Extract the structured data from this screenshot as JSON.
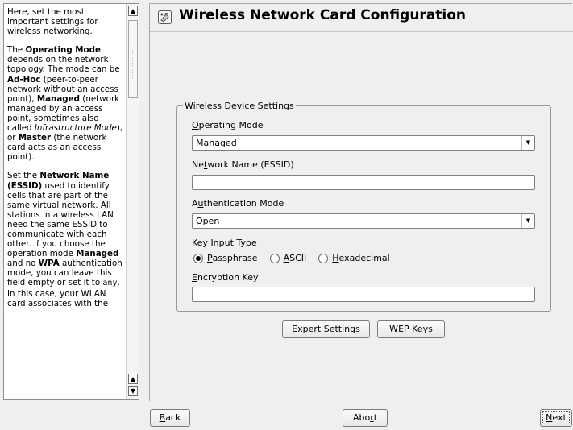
{
  "help": {
    "paragraphs": [
      [
        {
          "t": "Here, set the most important settings for wireless networking."
        }
      ],
      [
        {
          "t": "The "
        },
        {
          "t": "Operating Mode",
          "b": true
        },
        {
          "t": " depends on the network topology. The mode can be "
        },
        {
          "t": "Ad-Hoc",
          "b": true
        },
        {
          "t": " (peer-to-peer network without an access point), "
        },
        {
          "t": "Managed",
          "b": true
        },
        {
          "t": " (network managed by an access point, sometimes also called "
        },
        {
          "t": "Infrastructure Mode",
          "i": true
        },
        {
          "t": "), or "
        },
        {
          "t": "Master",
          "b": true
        },
        {
          "t": " (the network card acts as an access point)."
        }
      ],
      [
        {
          "t": "Set the "
        },
        {
          "t": "Network Name (ESSID)",
          "b": true
        },
        {
          "t": " used to identify cells that are part of the same virtual network. All stations in a wireless LAN need the same ESSID to communicate with each other. If you choose the operation mode "
        },
        {
          "t": "Managed",
          "b": true
        },
        {
          "t": " and no "
        },
        {
          "t": "WPA",
          "b": true
        },
        {
          "t": " authentication mode, you can leave this field empty or set it to "
        },
        {
          "t": "any",
          "code": true
        },
        {
          "t": ". In this case, your WLAN card associates with the"
        }
      ]
    ],
    "scroll_up_icon": "triangle-up",
    "scroll_down_icon": "triangle-down"
  },
  "page": {
    "title": "Wireless Network Card Configuration",
    "icon": "wireless-card-icon"
  },
  "group": {
    "title": "Wireless Device Settings",
    "operating_mode": {
      "label_mn": "O",
      "label_rest": "perating Mode",
      "value": "Managed"
    },
    "essid": {
      "label_pre": "Ne",
      "label_mn": "t",
      "label_rest": "work Name (ESSID)",
      "value": ""
    },
    "auth_mode": {
      "label_pre": "A",
      "label_mn": "u",
      "label_rest": "thentication Mode",
      "value": "Open"
    },
    "key_input": {
      "label": "Key Input Type",
      "options": [
        {
          "mn": "P",
          "rest": "assphrase",
          "checked": true
        },
        {
          "mn": "A",
          "rest": "SCII",
          "checked": false
        },
        {
          "mn": "H",
          "rest": "exadecimal",
          "checked": false
        }
      ]
    },
    "encryption_key": {
      "label_mn": "E",
      "label_rest": "ncryption Key",
      "value": ""
    }
  },
  "buttons": {
    "expert": {
      "pre": "E",
      "mn": "x",
      "rest": "pert Settings"
    },
    "wep": {
      "mn": "W",
      "rest": "EP Keys"
    },
    "back": {
      "mn": "B",
      "rest": "ack"
    },
    "abort": {
      "pre": "Abo",
      "mn": "r",
      "rest": "t"
    },
    "next": {
      "mn": "N",
      "rest": "ext"
    }
  }
}
